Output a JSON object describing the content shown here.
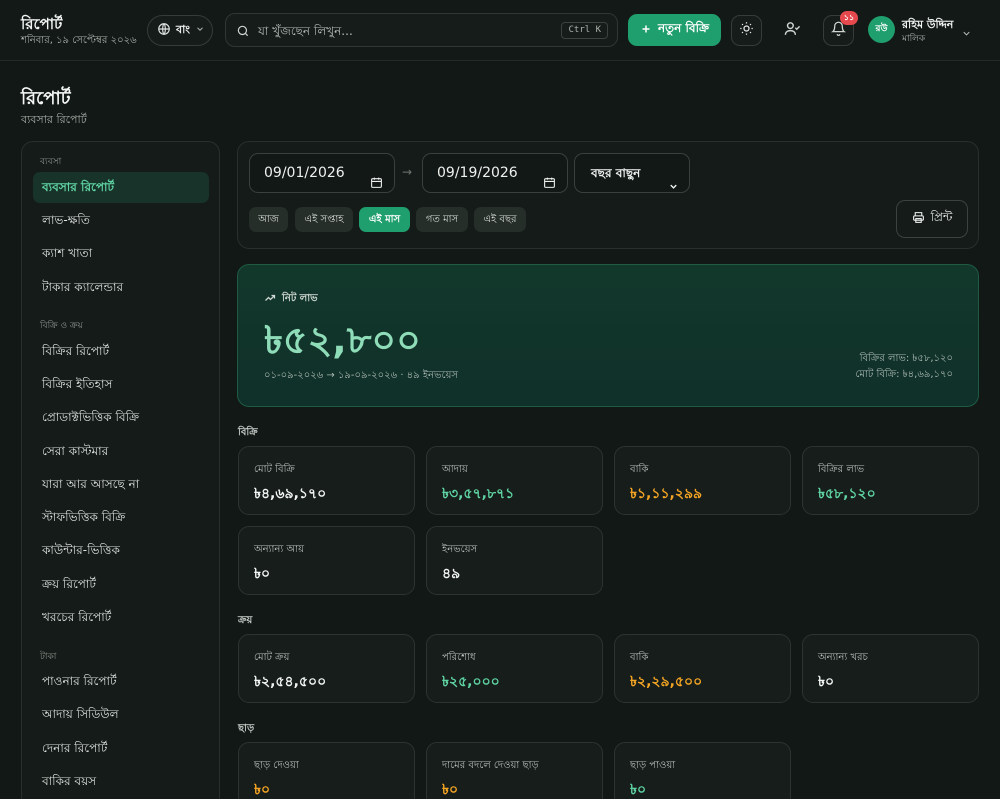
{
  "header": {
    "title": "রিপোর্ট",
    "date": "শনিবার, ১৯ সেপ্টেম্বর ২০২৬",
    "lang": "বাং",
    "search_placeholder": "যা খুঁজছেন লিখুন...",
    "search_shortcut": "Ctrl K",
    "new_sale": "নতুন বিক্রি",
    "notif_count": "১১",
    "avatar_initials": "রউ",
    "user_name": "রহিম উদ্দিন",
    "user_role": "মালিক"
  },
  "page": {
    "title": "রিপোর্ট",
    "subtitle": "ব্যবসার রিপোর্ট"
  },
  "sidebar": {
    "sections": [
      {
        "label": "ব্যবসা",
        "items": [
          "ব্যবসার রিপোর্ট",
          "লাভ-ক্ষতি",
          "ক্যাশ খাতা",
          "টাকার ক্যালেন্ডার"
        ]
      },
      {
        "label": "বিক্রি ও ক্রয়",
        "items": [
          "বিক্রির রিপোর্ট",
          "বিক্রির ইতিহাস",
          "প্রোডাক্টভিত্তিক বিক্রি",
          "সেরা কাস্টমার",
          "যারা আর আসছে না",
          "স্টাফভিত্তিক বিক্রি",
          "কাউন্টার-ভিত্তিক",
          "ক্রয় রিপোর্ট",
          "খরচের রিপোর্ট"
        ]
      },
      {
        "label": "টাকা",
        "items": [
          "পাওনার রিপোর্ট",
          "আদায় সিডিউল",
          "দেনার রিপোর্ট",
          "বাকির বয়স"
        ]
      }
    ],
    "active": "ব্যবসার রিপোর্ট"
  },
  "filters": {
    "date_from": "09/01/2026",
    "date_to": "09/19/2026",
    "arrow": "→",
    "year_select": "বছর বাছুন",
    "chips": [
      "আজ",
      "এই সপ্তাহ",
      "এই মাস",
      "গত মাস",
      "এই বছর"
    ],
    "active_chip": "এই মাস",
    "print": "প্রিন্ট"
  },
  "profit": {
    "label": "নিট লাভ",
    "value": "৳৫২,৮০০",
    "meta": "০১-০৯-২০২৬ → ১৯-০৯-২০২৬ · ৪৯ ইনভয়েস",
    "sales_profit": "বিক্রির লাভ: ৳৫৮,১২০",
    "total_sales": "মোট বিক্রি: ৳৪,৬৯,১৭০"
  },
  "sections": {
    "sales": {
      "label": "বিক্রি",
      "cards": [
        {
          "label": "মোট বিক্রি",
          "value": "৳৪,৬৯,১৭০",
          "tone": "default"
        },
        {
          "label": "আদায়",
          "value": "৳৩,৫৭,৮৭১",
          "tone": "green"
        },
        {
          "label": "বাকি",
          "value": "৳১,১১,২৯৯",
          "tone": "amber"
        },
        {
          "label": "বিক্রির লাভ",
          "value": "৳৫৮,১২০",
          "tone": "green"
        },
        {
          "label": "অন্যান্য আয়",
          "value": "৳০",
          "tone": "default"
        },
        {
          "label": "ইনভয়েস",
          "value": "৪৯",
          "tone": "default"
        }
      ]
    },
    "purchase": {
      "label": "ক্রয়",
      "cards": [
        {
          "label": "মোট ক্রয়",
          "value": "৳২,৫৪,৫০০",
          "tone": "default"
        },
        {
          "label": "পরিশোধ",
          "value": "৳২৫,০০০",
          "tone": "green"
        },
        {
          "label": "বাকি",
          "value": "৳২,২৯,৫০০",
          "tone": "amber"
        },
        {
          "label": "অন্যান্য খরচ",
          "value": "৳০",
          "tone": "default"
        }
      ]
    },
    "discount": {
      "label": "ছাড়",
      "cards": [
        {
          "label": "ছাড় দেওয়া",
          "value": "৳০",
          "tone": "amber"
        },
        {
          "label": "দামের বদলে দেওয়া ছাড়",
          "value": "৳০",
          "tone": "amber"
        },
        {
          "label": "ছাড় পাওয়া",
          "value": "৳০",
          "tone": "green"
        }
      ]
    }
  },
  "colors": {
    "accent": "#1f9e6e",
    "positive": "#5fd3a3",
    "warning": "#f5a524",
    "background": "#121815"
  }
}
